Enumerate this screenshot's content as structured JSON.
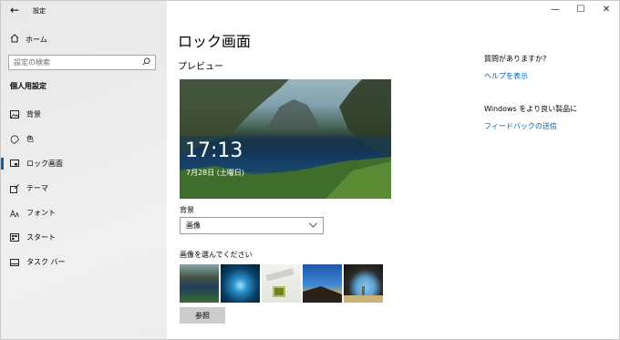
{
  "window": {
    "title": "設定",
    "back_icon": "back-arrow-icon",
    "minimize": "—",
    "maximize": "☐",
    "close": "✕"
  },
  "sidebar": {
    "home_label": "ホーム",
    "search_placeholder": "設定の検索",
    "section_title": "個人用設定",
    "items": [
      {
        "label": "背景",
        "icon": "image-icon"
      },
      {
        "label": "色",
        "icon": "palette-icon"
      },
      {
        "label": "ロック画面",
        "icon": "lock-screen-icon",
        "active": true
      },
      {
        "label": "テーマ",
        "icon": "theme-icon"
      },
      {
        "label": "フォント",
        "icon": "font-icon"
      },
      {
        "label": "スタート",
        "icon": "start-icon"
      },
      {
        "label": "タスク バー",
        "icon": "taskbar-icon"
      }
    ]
  },
  "main": {
    "page_title": "ロック画面",
    "preview_label": "プレビュー",
    "preview_time": "17:13",
    "preview_date": "7月28日 (土曜日)",
    "background_label": "背景",
    "background_value": "画像",
    "choose_label": "画像を選んでください",
    "browse_button": "参照"
  },
  "help": {
    "question": "質問がありますか?",
    "help_link": "ヘルプを表示",
    "improve_text": "Windows をより良い製品に",
    "feedback_link": "フィードバックの送信"
  },
  "colors": {
    "accent": "#0063b1",
    "sidebar_bg": "#ececec",
    "button_bg": "#cccccc"
  }
}
